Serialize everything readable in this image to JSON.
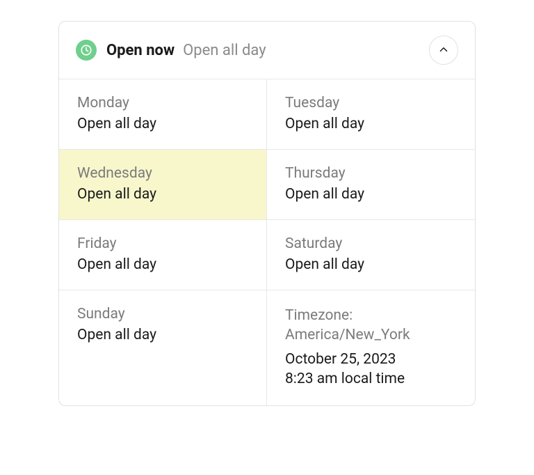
{
  "header": {
    "status": "Open now",
    "today_hours": "Open all day"
  },
  "days": [
    {
      "name": "Monday",
      "hours": "Open all day",
      "highlighted": false
    },
    {
      "name": "Tuesday",
      "hours": "Open all day",
      "highlighted": false
    },
    {
      "name": "Wednesday",
      "hours": "Open all day",
      "highlighted": true
    },
    {
      "name": "Thursday",
      "hours": "Open all day",
      "highlighted": false
    },
    {
      "name": "Friday",
      "hours": "Open all day",
      "highlighted": false
    },
    {
      "name": "Saturday",
      "hours": "Open all day",
      "highlighted": false
    },
    {
      "name": "Sunday",
      "hours": "Open all day",
      "highlighted": false
    }
  ],
  "timezone": {
    "label_prefix": "Timezone: ",
    "tz": "America/New_York",
    "date": "October 25, 2023",
    "time": "8:23 am local time"
  }
}
